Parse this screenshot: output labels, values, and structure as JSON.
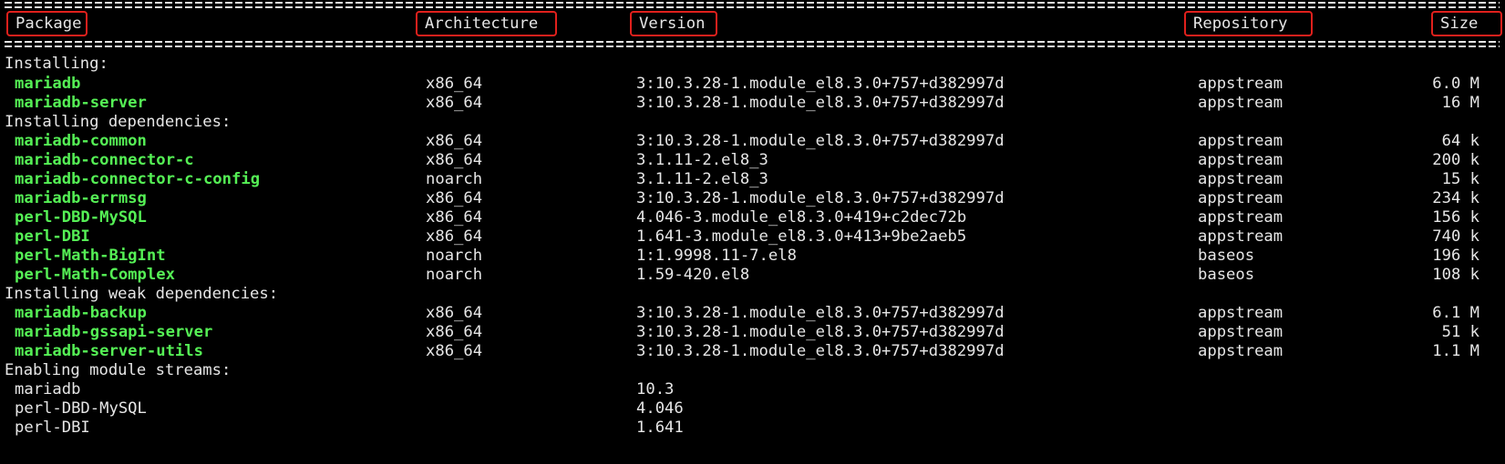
{
  "headers": {
    "package": "Package",
    "architecture": "Architecture",
    "version": "Version",
    "repository": "Repository",
    "size": "Size"
  },
  "colors": {
    "background": "#000000",
    "text": "#e6e6e6",
    "package_name": "#55f055",
    "header_highlight_box": "#e0201c"
  },
  "sections": [
    {
      "title": "Installing:",
      "rows": [
        {
          "package": "mariadb",
          "arch": "x86_64",
          "version": "3:10.3.28-1.module_el8.3.0+757+d382997d",
          "repo": "appstream",
          "size": "6.0 M"
        },
        {
          "package": "mariadb-server",
          "arch": "x86_64",
          "version": "3:10.3.28-1.module_el8.3.0+757+d382997d",
          "repo": "appstream",
          "size": "16 M"
        }
      ]
    },
    {
      "title": "Installing dependencies:",
      "rows": [
        {
          "package": "mariadb-common",
          "arch": "x86_64",
          "version": "3:10.3.28-1.module_el8.3.0+757+d382997d",
          "repo": "appstream",
          "size": "64 k"
        },
        {
          "package": "mariadb-connector-c",
          "arch": "x86_64",
          "version": "3.1.11-2.el8_3",
          "repo": "appstream",
          "size": "200 k"
        },
        {
          "package": "mariadb-connector-c-config",
          "arch": "noarch",
          "version": "3.1.11-2.el8_3",
          "repo": "appstream",
          "size": "15 k"
        },
        {
          "package": "mariadb-errmsg",
          "arch": "x86_64",
          "version": "3:10.3.28-1.module_el8.3.0+757+d382997d",
          "repo": "appstream",
          "size": "234 k"
        },
        {
          "package": "perl-DBD-MySQL",
          "arch": "x86_64",
          "version": "4.046-3.module_el8.3.0+419+c2dec72b",
          "repo": "appstream",
          "size": "156 k"
        },
        {
          "package": "perl-DBI",
          "arch": "x86_64",
          "version": "1.641-3.module_el8.3.0+413+9be2aeb5",
          "repo": "appstream",
          "size": "740 k"
        },
        {
          "package": "perl-Math-BigInt",
          "arch": "noarch",
          "version": "1:1.9998.11-7.el8",
          "repo": "baseos",
          "size": "196 k"
        },
        {
          "package": "perl-Math-Complex",
          "arch": "noarch",
          "version": "1.59-420.el8",
          "repo": "baseos",
          "size": "108 k"
        }
      ]
    },
    {
      "title": "Installing weak dependencies:",
      "rows": [
        {
          "package": "mariadb-backup",
          "arch": "x86_64",
          "version": "3:10.3.28-1.module_el8.3.0+757+d382997d",
          "repo": "appstream",
          "size": "6.1 M"
        },
        {
          "package": "mariadb-gssapi-server",
          "arch": "x86_64",
          "version": "3:10.3.28-1.module_el8.3.0+757+d382997d",
          "repo": "appstream",
          "size": "51 k"
        },
        {
          "package": "mariadb-server-utils",
          "arch": "x86_64",
          "version": "3:10.3.28-1.module_el8.3.0+757+d382997d",
          "repo": "appstream",
          "size": "1.1 M"
        }
      ]
    }
  ],
  "module_streams": {
    "title": "Enabling module streams:",
    "rows": [
      {
        "module": "mariadb",
        "stream": "10.3"
      },
      {
        "module": "perl-DBD-MySQL",
        "stream": "4.046"
      },
      {
        "module": "perl-DBI",
        "stream": "1.641"
      }
    ]
  }
}
